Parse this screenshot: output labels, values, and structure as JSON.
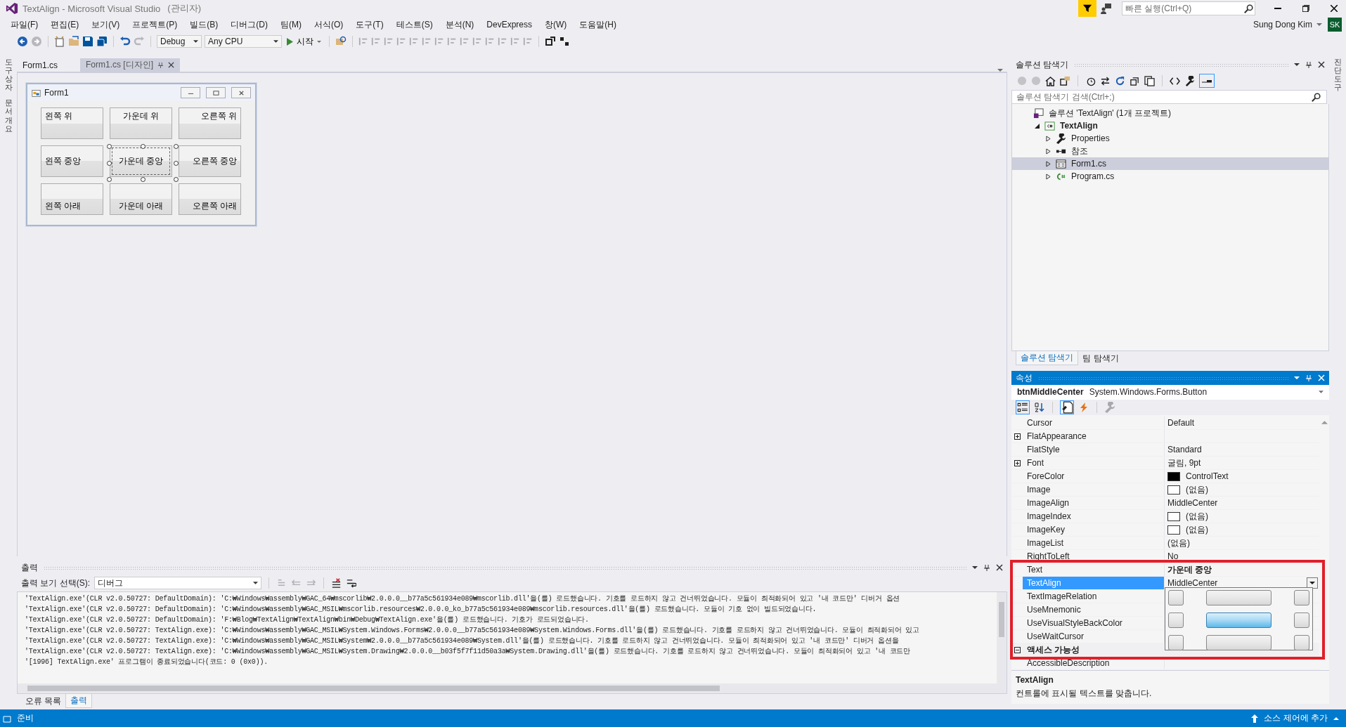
{
  "window": {
    "title": "TextAlign - Microsoft Visual Studio",
    "admin": "(관리자)"
  },
  "quick_launch": {
    "placeholder": "빠른 실행(Ctrl+Q)"
  },
  "user": {
    "name": "Sung Dong Kim",
    "initials": "SK"
  },
  "menu": [
    "파일(F)",
    "편집(E)",
    "보기(V)",
    "프로젝트(P)",
    "빌드(B)",
    "디버그(D)",
    "팀(M)",
    "서식(O)",
    "도구(T)",
    "테스트(S)",
    "분석(N)",
    "DevExpress",
    "창(W)",
    "도움말(H)"
  ],
  "toolbar": {
    "configuration": "Debug",
    "platform": "Any CPU",
    "start": "시작"
  },
  "side_tabs_left": [
    "도구 상자",
    "문서 개요"
  ],
  "side_tabs_right": [
    "진단 도구"
  ],
  "document_tabs": [
    {
      "label": "Form1.cs",
      "selected": false
    },
    {
      "label": "Form1.cs [디자인]",
      "selected": true
    }
  ],
  "form": {
    "title": "Form1",
    "buttons": [
      {
        "text": "왼쪽 위",
        "kind": "topleft",
        "selected": false
      },
      {
        "text": "가운데 위",
        "kind": "topcenter",
        "selected": false
      },
      {
        "text": "오른쪽 위",
        "kind": "topright",
        "selected": false
      },
      {
        "text": "왼쪽 중앙",
        "kind": "middleleft",
        "selected": false
      },
      {
        "text": "가운데 중앙",
        "kind": "middlecenter",
        "selected": true
      },
      {
        "text": "오른쪽 중앙",
        "kind": "middleright",
        "selected": false
      },
      {
        "text": "왼쪽 아래",
        "kind": "bottomleft",
        "selected": false
      },
      {
        "text": "가운데 아래",
        "kind": "bottomcenter",
        "selected": false
      },
      {
        "text": "오른쪽 아래",
        "kind": "bottomright",
        "selected": false
      }
    ]
  },
  "output": {
    "title": "출력",
    "source_label": "출력 보기 선택(S):",
    "source": "디버그",
    "lines": [
      "'TextAlign.exe'(CLR v2.0.50727: DefaultDomain): 'C:₩Windows₩assembly₩GAC_64₩mscorlib₩2.0.0.0__b77a5c561934e089₩mscorlib.dll'을(를) 로드했습니다. 기호를 로드하지 않고 건너뛰었습니다. 모듈이 최적화되어 있고 '내 코드만' 디버거 옵션",
      "'TextAlign.exe'(CLR v2.0.50727: DefaultDomain): 'C:₩Windows₩assembly₩GAC_MSIL₩mscorlib.resources₩2.0.0.0_ko_b77a5c561934e089₩mscorlib.resources.dll'을(를) 로드했습니다. 모듈이 기호 없이 빌드되었습니다.",
      "'TextAlign.exe'(CLR v2.0.50727: DefaultDomain): 'F:₩Blog₩TextAlign₩TextAlign₩bin₩Debug₩TextAlign.exe'을(를) 로드했습니다. 기호가 로드되었습니다.",
      "'TextAlign.exe'(CLR v2.0.50727: TextAlign.exe): 'C:₩Windows₩assembly₩GAC_MSIL₩System.Windows.Forms₩2.0.0.0__b77a5c561934e089₩System.Windows.Forms.dll'을(를) 로드했습니다. 기호를 로드하지 않고 건너뛰었습니다. 모듈이 최적화되어 있고",
      "'TextAlign.exe'(CLR v2.0.50727: TextAlign.exe): 'C:₩Windows₩assembly₩GAC_MSIL₩System₩2.0.0.0__b77a5c561934e089₩System.dll'을(를) 로드했습니다. 기호를 로드하지 않고 건너뛰었습니다. 모듈이 최적화되어 있고 '내 코드만' 디버거 옵션을",
      "'TextAlign.exe'(CLR v2.0.50727: TextAlign.exe): 'C:₩Windows₩assembly₩GAC_MSIL₩System.Drawing₩2.0.0.0__b03f5f7f11d50a3a₩System.Drawing.dll'을(를) 로드했습니다. 기호를 로드하지 않고 건너뛰었습니다. 모듈이 최적화되어 있고 '내 코드만",
      "'[1996] TextAlign.exe' 프로그램이 종료되었습니다(코드: 0 (0x0))."
    ],
    "tabs": [
      {
        "label": "오류 목록",
        "selected": false
      },
      {
        "label": "출력",
        "selected": true
      }
    ]
  },
  "solution_explorer": {
    "title": "솔루션 탐색기",
    "search_placeholder": "솔루션 탐색기 검색(Ctrl+;)",
    "tree": [
      {
        "label": "솔루션 'TextAlign' (1개 프로젝트)",
        "kind": "solution",
        "selected": false,
        "children": [
          {
            "label": "TextAlign",
            "kind": "project",
            "bold": true,
            "expanded": true,
            "selected": false,
            "children": [
              {
                "label": "Properties",
                "kind": "properties",
                "expanded": false,
                "selected": false
              },
              {
                "label": "참조",
                "kind": "references",
                "expanded": false,
                "selected": false
              },
              {
                "label": "Form1.cs",
                "kind": "form",
                "expanded": false,
                "selected": true
              },
              {
                "label": "Program.cs",
                "kind": "code",
                "expanded": false,
                "selected": false
              }
            ]
          }
        ]
      }
    ],
    "tabs": [
      {
        "label": "솔루션 탐색기",
        "selected": true
      },
      {
        "label": "팀 탐색기",
        "selected": false
      }
    ]
  },
  "properties": {
    "title": "속성",
    "object_name": "btnMiddleCenter",
    "object_type": "System.Windows.Forms.Button",
    "rows": [
      {
        "kind": "property",
        "name": "Cursor",
        "value": "Default",
        "selected": false
      },
      {
        "kind": "property",
        "name": "FlatAppearance",
        "expanded": false,
        "selected": false
      },
      {
        "kind": "property",
        "name": "FlatStyle",
        "value": "Standard",
        "selected": false
      },
      {
        "kind": "property",
        "name": "Font",
        "value": "굴림, 9pt",
        "expanded": false,
        "selected": false
      },
      {
        "kind": "property",
        "name": "ForeColor",
        "value": "ControlText",
        "color": "#000000",
        "selected": false
      },
      {
        "kind": "property",
        "name": "Image",
        "value": "(없음)",
        "color": "#ffffff",
        "selected": false
      },
      {
        "kind": "property",
        "name": "ImageAlign",
        "value": "MiddleCenter",
        "selected": false
      },
      {
        "kind": "property",
        "name": "ImageIndex",
        "value": "(없음)",
        "color": "#ffffff",
        "selected": false
      },
      {
        "kind": "property",
        "name": "ImageKey",
        "value": "(없음)",
        "color": "#ffffff",
        "selected": false
      },
      {
        "kind": "property",
        "name": "ImageList",
        "value": "(없음)",
        "selected": false
      },
      {
        "kind": "property",
        "name": "RightToLeft",
        "value": "No",
        "selected": false
      },
      {
        "kind": "property",
        "name": "Text",
        "value": "가운데 중앙",
        "modified": true,
        "selected": false
      },
      {
        "kind": "property",
        "name": "TextAlign",
        "value": "MiddleCenter",
        "dropdown": true,
        "selected": true
      },
      {
        "kind": "property",
        "name": "TextImageRelation",
        "selected": false
      },
      {
        "kind": "property",
        "name": "UseMnemonic",
        "selected": false
      },
      {
        "kind": "property",
        "name": "UseVisualStyleBackColor",
        "selected": false
      },
      {
        "kind": "property",
        "name": "UseWaitCursor",
        "selected": false
      },
      {
        "kind": "category",
        "name": "액세스 가능성",
        "expanded": true,
        "selected": false
      },
      {
        "kind": "property",
        "name": "AccessibleDescription",
        "selected": false
      }
    ],
    "align_picker": {
      "options": [
        {
          "selected": false
        },
        {
          "selected": false
        },
        {
          "selected": false
        },
        {
          "selected": false
        },
        {
          "selected": true
        },
        {
          "selected": false
        },
        {
          "selected": false
        },
        {
          "selected": false
        },
        {
          "selected": false
        }
      ]
    },
    "description": {
      "title": "TextAlign",
      "text": "컨트롤에 표시될 텍스트를 맞춥니다."
    }
  },
  "status_bar": {
    "text": "준비",
    "source_control": "소스 제어에 추가"
  }
}
